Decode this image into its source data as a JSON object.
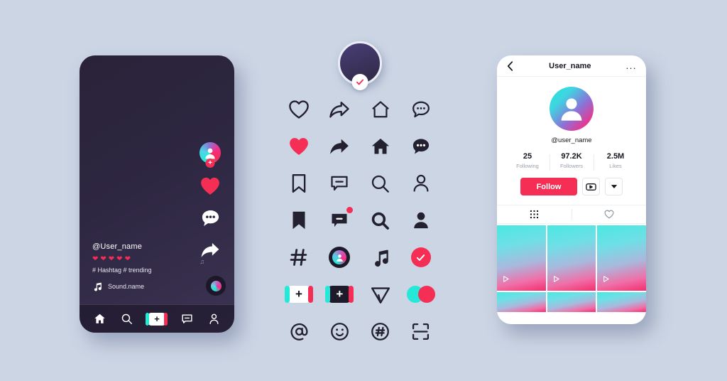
{
  "theme": {
    "background": "#ccd5e4",
    "accent_pink": "#f42e55",
    "accent_cyan": "#25e8d8",
    "dark": "#1d1a29"
  },
  "feed_phone": {
    "username": "@User_name",
    "hearts": [
      "heart",
      "heart",
      "heart",
      "heart",
      "heart"
    ],
    "hashtags": "# Hashtag  # trending",
    "sound_name": "Sound.name",
    "rail": [
      {
        "name": "avatar-follow",
        "icon": "avatar-plus-icon"
      },
      {
        "name": "like",
        "icon": "heart-filled-icon"
      },
      {
        "name": "comment",
        "icon": "comment-filled-icon"
      },
      {
        "name": "share",
        "icon": "share-arrow-icon"
      }
    ],
    "bottom_nav": [
      {
        "name": "home",
        "icon": "home-filled-icon"
      },
      {
        "name": "discover",
        "icon": "search-icon"
      },
      {
        "name": "create",
        "icon": "plus-create-icon",
        "label": "+"
      },
      {
        "name": "inbox",
        "icon": "comment-outline-icon"
      },
      {
        "name": "profile",
        "icon": "person-outline-icon"
      }
    ]
  },
  "badge": {
    "name": "verified-avatar-badge",
    "check": "check-icon"
  },
  "icon_grid": {
    "rows": [
      [
        {
          "name": "heart-outline-icon",
          "label": "heart outline"
        },
        {
          "name": "share-outline-icon",
          "label": "share outline"
        },
        {
          "name": "home-outline-icon",
          "label": "home outline"
        },
        {
          "name": "chat-outline-icon",
          "label": "chat outline"
        }
      ],
      [
        {
          "name": "heart-filled-icon",
          "label": "heart filled"
        },
        {
          "name": "share-filled-icon",
          "label": "share filled"
        },
        {
          "name": "home-filled-icon",
          "label": "home filled"
        },
        {
          "name": "chat-filled-icon",
          "label": "chat filled"
        }
      ],
      [
        {
          "name": "bookmark-outline-icon",
          "label": "bookmark outline"
        },
        {
          "name": "comment-outline-icon",
          "label": "comment outline"
        },
        {
          "name": "search-outline-icon",
          "label": "search outline"
        },
        {
          "name": "person-outline-icon",
          "label": "person outline"
        }
      ],
      [
        {
          "name": "bookmark-filled-icon",
          "label": "bookmark filled"
        },
        {
          "name": "comment-notification-icon",
          "label": "comment with badge"
        },
        {
          "name": "search-filled-icon",
          "label": "search filled"
        },
        {
          "name": "person-filled-icon",
          "label": "person filled"
        }
      ],
      [
        {
          "name": "hashtag-icon",
          "label": "hashtag"
        },
        {
          "name": "avatar-icon",
          "label": "avatar"
        },
        {
          "name": "music-note-icon",
          "label": "music note"
        },
        {
          "name": "check-circle-icon",
          "label": "verified check"
        }
      ],
      [
        {
          "name": "create-light-icon",
          "label": "+"
        },
        {
          "name": "create-dark-icon",
          "label": "+"
        },
        {
          "name": "send-outline-icon",
          "label": "send"
        },
        {
          "name": "duo-circles-icon",
          "label": "two circles"
        }
      ],
      [
        {
          "name": "mention-icon",
          "label": "at mention"
        },
        {
          "name": "smiley-icon",
          "label": "smiley"
        },
        {
          "name": "hashtag-circle-icon",
          "label": "hashtag circle"
        },
        {
          "name": "scan-icon",
          "label": "scan frame"
        }
      ]
    ]
  },
  "profile_phone": {
    "header": {
      "back": "back-chevron-icon",
      "title": "User_name",
      "menu": "..."
    },
    "handle": "@user_name",
    "stats": [
      {
        "value": "25",
        "label": "Following"
      },
      {
        "value": "97.2K",
        "label": "Followers"
      },
      {
        "value": "2.5M",
        "label": "Likes"
      }
    ],
    "follow_label": "Follow",
    "tabs": [
      {
        "name": "grid-tab",
        "icon": "grid-dots-icon"
      },
      {
        "name": "liked-tab",
        "icon": "heart-outline-icon"
      }
    ],
    "thumbs": [
      {
        "play": "play-icon"
      },
      {
        "play": "play-icon"
      },
      {
        "play": "play-icon"
      }
    ]
  }
}
